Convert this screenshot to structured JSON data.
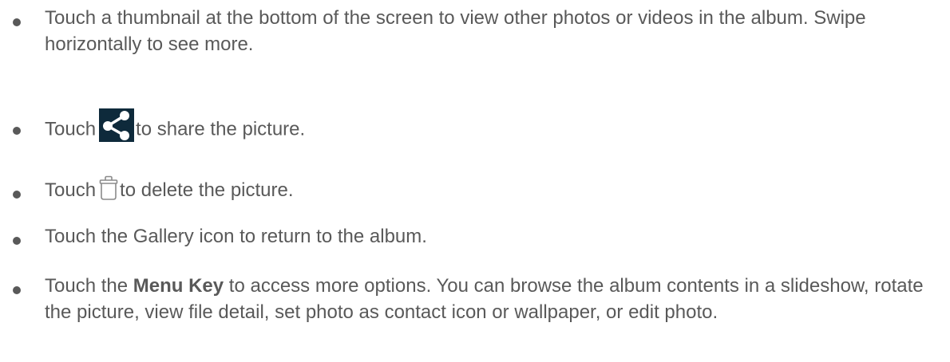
{
  "bullets": [
    {
      "text": "Touch a thumbnail at the bottom of the screen to view other photos or videos in the album. Swipe horizontally to see more."
    },
    {
      "before": "Touch",
      "icon": "share-icon",
      "after": "to share the picture."
    },
    {
      "before": "Touch",
      "icon": "trash-icon",
      "after": "to delete the picture."
    },
    {
      "text": "Touch the Gallery icon to return to the album."
    },
    {
      "before": "Touch the",
      "bold": "Menu Key",
      "after": "to access more options. You can browse the album contents in a slideshow, rotate the picture, view file detail, set photo as contact icon or wallpaper, or edit photo."
    }
  ],
  "colors": {
    "text": "#595959",
    "share_icon_bg": "#0e2a3b",
    "share_icon_fg": "#ffffff",
    "trash_icon_stroke": "#8a8a8a"
  }
}
